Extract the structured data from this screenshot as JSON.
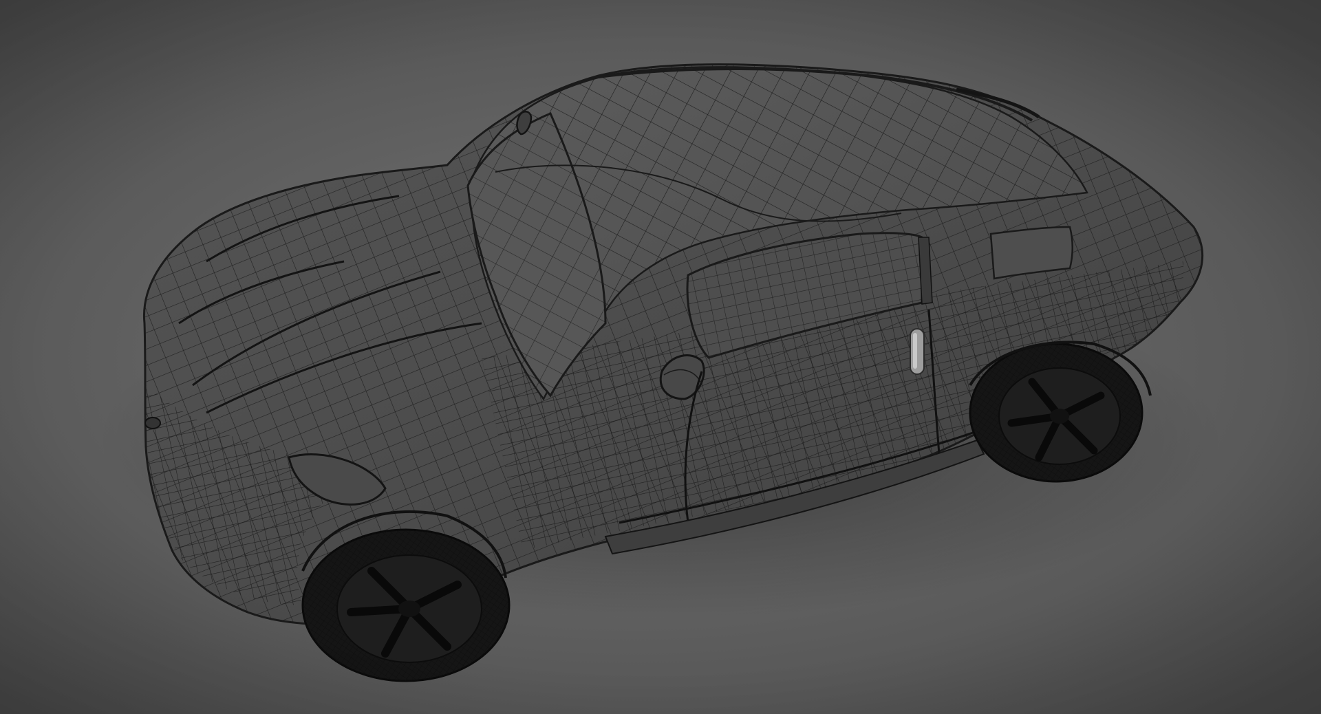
{
  "scene": {
    "subject": "car-wireframe-render",
    "render_style": "wireframe-on-shaded",
    "colors": {
      "background": "#5f5f5f",
      "body": "#4d4d4d",
      "body_shadow": "#3a3a3a",
      "glass": "#555555",
      "wire": "#1a1a1a",
      "tire": "#141414",
      "rim": "#262626",
      "chrome": "#a9a9a9"
    }
  }
}
